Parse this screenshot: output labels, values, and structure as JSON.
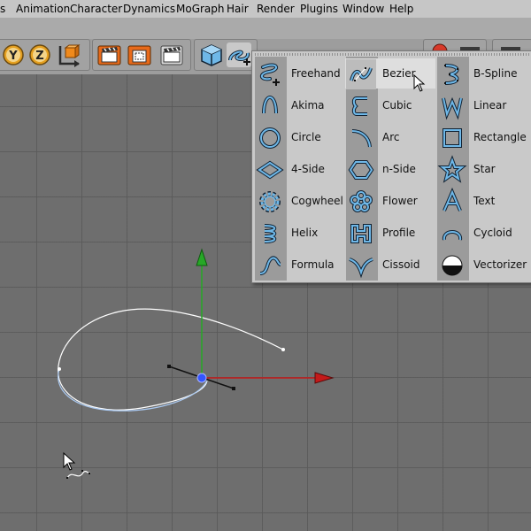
{
  "menubar": {
    "items": [
      "s",
      "Animation",
      "Character",
      "Dynamics",
      "MoGraph",
      "Hair",
      "Render",
      "Plugins",
      "Window",
      "Help"
    ]
  },
  "toolbar": {
    "buttons": [
      {
        "icon": "y-axis-lock-icon",
        "text": "Y"
      },
      {
        "icon": "z-axis-lock-icon",
        "text": "Z"
      },
      {
        "icon": "coordinate-system-icon"
      },
      {
        "icon": "render-view-icon"
      },
      {
        "icon": "render-region-icon"
      },
      {
        "icon": "render-settings-icon"
      },
      {
        "icon": "cube-icon"
      },
      {
        "icon": "spline-tools-icon"
      }
    ]
  },
  "spline_menu": {
    "items": [
      {
        "label": "Freehand",
        "icon": "freehand-spline-icon",
        "active": false
      },
      {
        "label": "Akima",
        "icon": "akima-spline-icon",
        "active": false
      },
      {
        "label": "Circle",
        "icon": "circle-spline-icon",
        "active": false
      },
      {
        "label": "4-Side",
        "icon": "four-side-spline-icon",
        "active": false
      },
      {
        "label": "Cogwheel",
        "icon": "cogwheel-spline-icon",
        "active": false
      },
      {
        "label": "Helix",
        "icon": "helix-spline-icon",
        "active": false
      },
      {
        "label": "Formula",
        "icon": "formula-spline-icon",
        "active": false
      },
      {
        "label": "Bezier",
        "icon": "bezier-spline-icon",
        "active": true
      },
      {
        "label": "Cubic",
        "icon": "cubic-spline-icon",
        "active": false
      },
      {
        "label": "Arc",
        "icon": "arc-spline-icon",
        "active": false
      },
      {
        "label": "n-Side",
        "icon": "n-side-spline-icon",
        "active": false
      },
      {
        "label": "Flower",
        "icon": "flower-spline-icon",
        "active": false
      },
      {
        "label": "Profile",
        "icon": "profile-spline-icon",
        "active": false
      },
      {
        "label": "Cissoid",
        "icon": "cissoid-spline-icon",
        "active": false
      },
      {
        "label": "B-Spline",
        "icon": "b-spline-icon",
        "active": false
      },
      {
        "label": "Linear",
        "icon": "linear-spline-icon",
        "active": false
      },
      {
        "label": "Rectangle",
        "icon": "rectangle-spline-icon",
        "active": false
      },
      {
        "label": "Star",
        "icon": "star-spline-icon",
        "active": false
      },
      {
        "label": "Text",
        "icon": "text-spline-icon",
        "active": false
      },
      {
        "label": "Cycloid",
        "icon": "cycloid-spline-icon",
        "active": false
      },
      {
        "label": "Vectorizer",
        "icon": "vectorizer-spline-icon",
        "active": false
      }
    ]
  },
  "viewport": {
    "axis_colors": {
      "x": "#c41a1a",
      "y": "#27a827",
      "object": "#3355ff"
    },
    "spline_color": "#ffffff",
    "spline_selected_color": "#a9c8f0",
    "grid_color": "#5a5a5a"
  },
  "colors": {
    "accent_icon": "#6fb8e8",
    "menu_bg": "#c9c9c9",
    "icon_column": "#9b9b9b",
    "highlight": "#dedede"
  }
}
